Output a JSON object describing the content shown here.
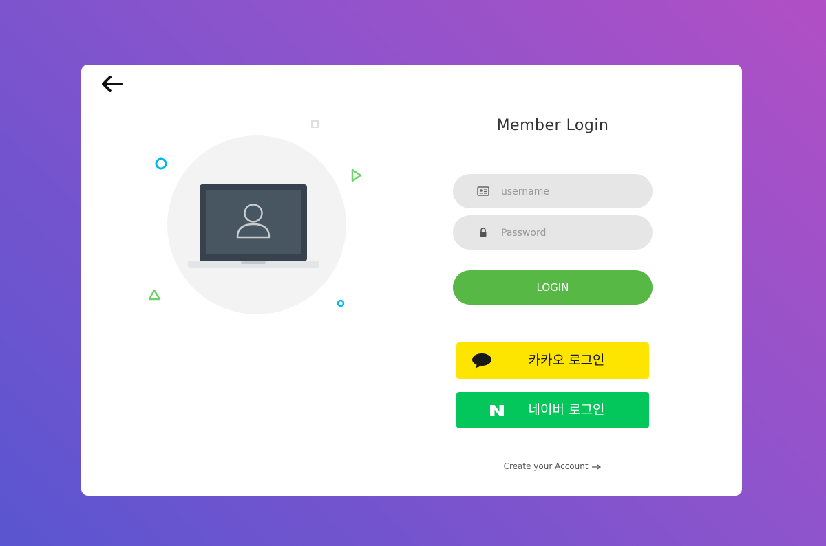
{
  "login": {
    "title": "Member Login",
    "username_placeholder": "username",
    "password_placeholder": "Password",
    "login_button": "LOGIN",
    "kakao_button": "카카오 로그인",
    "naver_button": "네이버 로그인",
    "create_account": "Create your Account"
  },
  "icons": {
    "back": "arrow-left-icon",
    "username": "id-card-icon",
    "password": "lock-icon",
    "kakao": "speech-bubble-icon",
    "naver": "naver-n-icon",
    "create_account": "arrow-right-icon"
  },
  "colors": {
    "login_button": "#57b846",
    "kakao": "#fee500",
    "naver": "#03c75a",
    "field_bg": "#e6e6e6"
  }
}
